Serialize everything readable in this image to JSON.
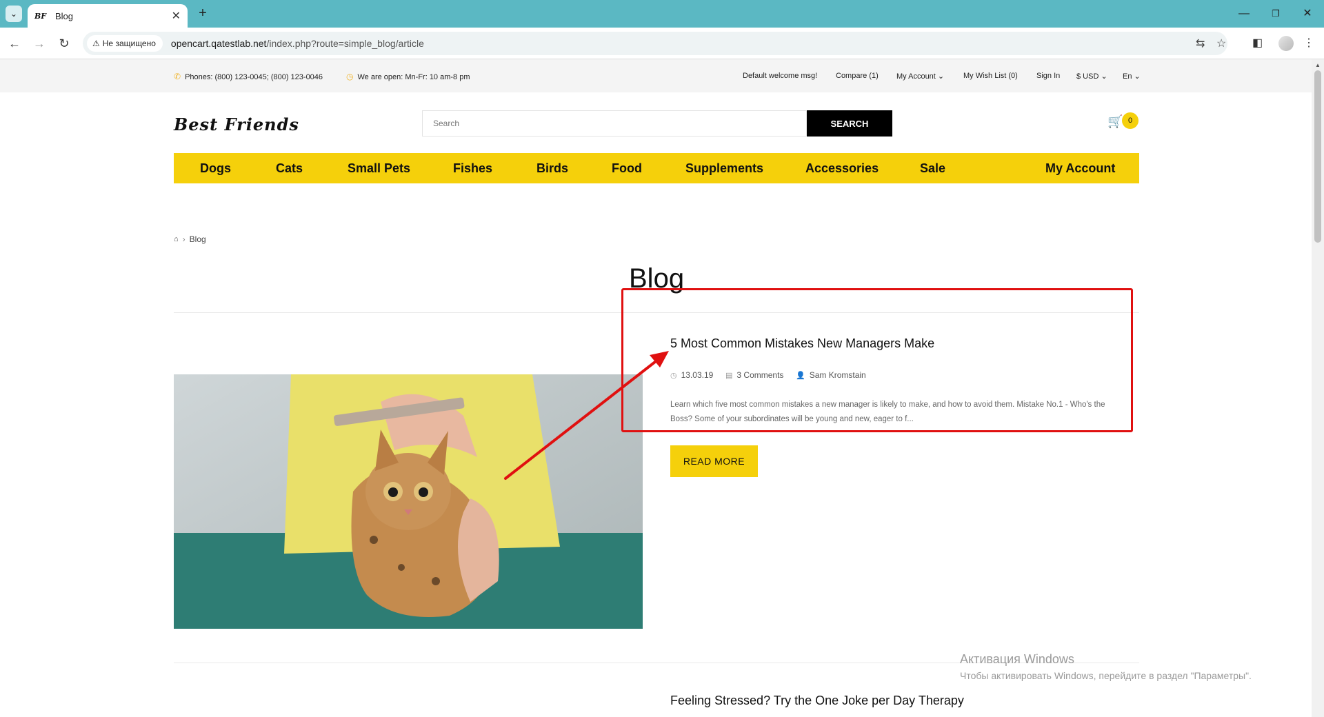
{
  "browser": {
    "tab_title": "Blog",
    "tab_favicon": "BF",
    "security_label": "Не защищено",
    "url_host": "opencart.qatestlab.net",
    "url_path": "/index.php?route=simple_blog/article"
  },
  "topbar": {
    "phones": "Phones: (800) 123-0045; (800) 123-0046",
    "hours": "We are open: Mn-Fr: 10 am-8 pm",
    "welcome": "Default welcome msg!",
    "compare": "Compare (1)",
    "my_account": "My Account",
    "wishlist": "My Wish List (0)",
    "sign_in": "Sign In",
    "currency": "$ USD",
    "language": "En"
  },
  "header": {
    "logo": "Best Friends",
    "search_placeholder": "Search",
    "search_button": "SEARCH",
    "cart_count": "0"
  },
  "nav": {
    "items": [
      "Dogs",
      "Cats",
      "Small Pets",
      "Fishes",
      "Birds",
      "Food",
      "Supplements",
      "Accessories",
      "Sale"
    ],
    "my_account": "My Account"
  },
  "breadcrumb": {
    "current": "Blog"
  },
  "page": {
    "title": "Blog"
  },
  "articles": [
    {
      "title": "5 Most Common Mistakes New Managers Make",
      "date": "13.03.19",
      "comments": "3 Comments",
      "author": "Sam Kromstain",
      "excerpt": "Learn which five most common mistakes a new manager is likely to make, and how to avoid them. Mistake No.1 - Who's the Boss? Some of your subordinates will be young and new, eager to f...",
      "read_more": "READ MORE"
    },
    {
      "title": "Feeling Stressed? Try the One Joke per Day Therapy"
    }
  ],
  "overlay": {
    "activation_title": "Активация Windows",
    "activation_sub": "Чтобы активировать Windows, перейдите в раздел \"Параметры\"."
  },
  "colors": {
    "chrome_tab_bar": "#5bb8c3",
    "accent_yellow": "#f5d00b",
    "annotation_red": "#e01010"
  }
}
